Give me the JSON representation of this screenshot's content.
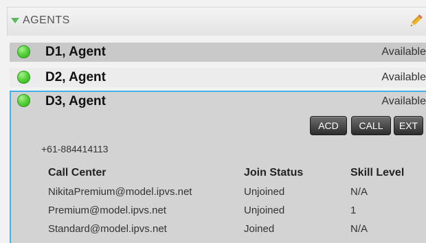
{
  "header": {
    "title": "AGENTS",
    "collapse_icon": "triangle-down-icon",
    "edit_icon": "pencil-icon"
  },
  "colors": {
    "header_accent": "#5cb85c",
    "selection_border": "#43b1e8",
    "available": "#3cc12a"
  },
  "agents": [
    {
      "name": "D1, Agent",
      "status": "Available"
    },
    {
      "name": "D2, Agent",
      "status": "Available"
    },
    {
      "name": "D3, Agent",
      "status": "Available"
    }
  ],
  "expanded": {
    "buttons": {
      "acd": "ACD",
      "call": "CALL",
      "ext": "EXT"
    },
    "phone": "+61-884414113",
    "table": {
      "headers": {
        "call_center": "Call Center",
        "join_status": "Join Status",
        "skill_level": "Skill Level"
      },
      "rows": [
        {
          "call_center": "NikitaPremium@model.ipvs.net",
          "join_status": "Unjoined",
          "skill_level": "N/A"
        },
        {
          "call_center": "Premium@model.ipvs.net",
          "join_status": "Unjoined",
          "skill_level": "1"
        },
        {
          "call_center": "Standard@model.ipvs.net",
          "join_status": "Joined",
          "skill_level": "N/A"
        }
      ]
    }
  }
}
